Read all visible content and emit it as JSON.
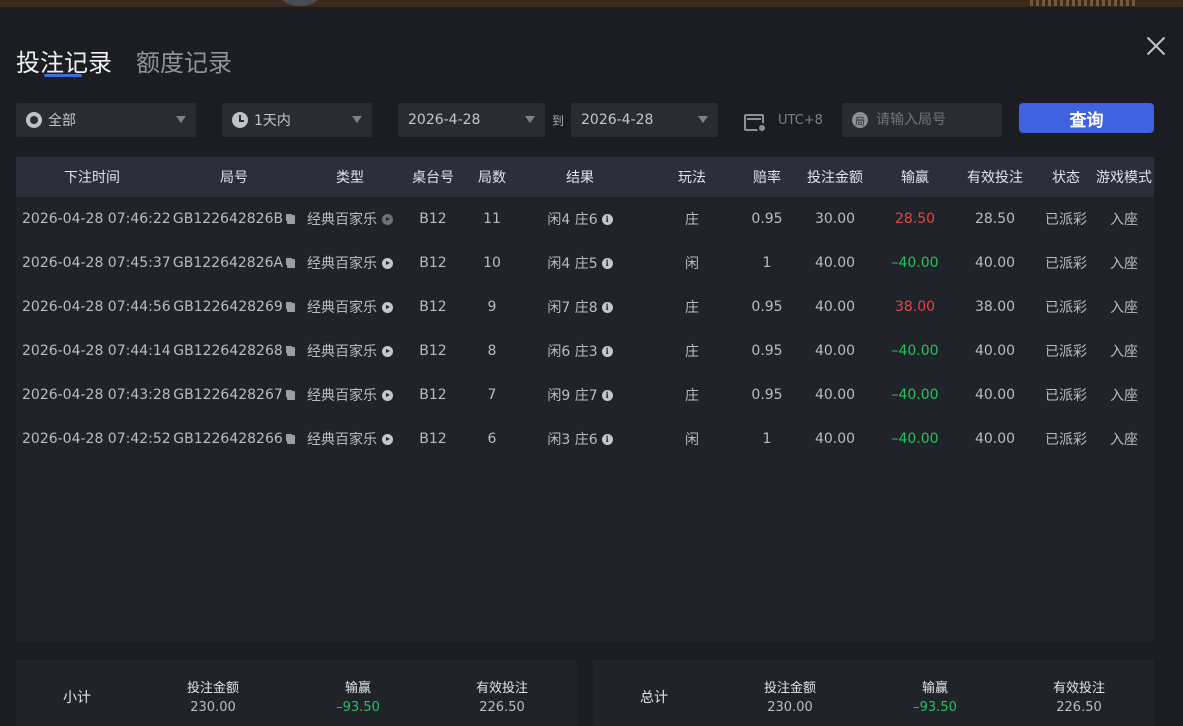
{
  "tabs": [
    {
      "label": "投注记录",
      "active": true
    },
    {
      "label": "额度记录",
      "active": false
    }
  ],
  "filters": {
    "game_type": "全部",
    "time_range": "1天内",
    "date_from": "2026-4-28",
    "to_label": "到",
    "date_to": "2026-4-28",
    "timezone": "UTC+8",
    "round_placeholder": "请输入局号",
    "round_icon_char": "局",
    "query_label": "查询"
  },
  "table": {
    "headers": [
      "下注时间",
      "局号",
      "类型",
      "桌台号",
      "局数",
      "结果",
      "玩法",
      "赔率",
      "投注金额",
      "输赢",
      "有效投注",
      "状态",
      "游戏模式"
    ],
    "rows": [
      {
        "time": "2026-04-28 07:46:22",
        "round": "GB122642826B",
        "type": "经典百家乐",
        "table": "B12",
        "count": "11",
        "result": "闲4 庄6",
        "play": "庄",
        "odds": "0.95",
        "bet": "30.00",
        "winloss": "28.50",
        "effective": "28.50",
        "status": "已派彩",
        "mode": "入座"
      },
      {
        "time": "2026-04-28 07:45:37",
        "round": "GB122642826A",
        "type": "经典百家乐",
        "table": "B12",
        "count": "10",
        "result": "闲4 庄5",
        "play": "闲",
        "odds": "1",
        "bet": "40.00",
        "winloss": "–40.00",
        "effective": "40.00",
        "status": "已派彩",
        "mode": "入座"
      },
      {
        "time": "2026-04-28 07:44:56",
        "round": "GB1226428269",
        "type": "经典百家乐",
        "table": "B12",
        "count": "9",
        "result": "闲7 庄8",
        "play": "庄",
        "odds": "0.95",
        "bet": "40.00",
        "winloss": "38.00",
        "effective": "38.00",
        "status": "已派彩",
        "mode": "入座"
      },
      {
        "time": "2026-04-28 07:44:14",
        "round": "GB1226428268",
        "type": "经典百家乐",
        "table": "B12",
        "count": "8",
        "result": "闲6 庄3",
        "play": "庄",
        "odds": "0.95",
        "bet": "40.00",
        "winloss": "–40.00",
        "effective": "40.00",
        "status": "已派彩",
        "mode": "入座"
      },
      {
        "time": "2026-04-28 07:43:28",
        "round": "GB1226428267",
        "type": "经典百家乐",
        "table": "B12",
        "count": "7",
        "result": "闲9 庄7",
        "play": "庄",
        "odds": "0.95",
        "bet": "40.00",
        "winloss": "–40.00",
        "effective": "40.00",
        "status": "已派彩",
        "mode": "入座"
      },
      {
        "time": "2026-04-28 07:42:52",
        "round": "GB1226428266",
        "type": "经典百家乐",
        "table": "B12",
        "count": "6",
        "result": "闲3 庄6",
        "play": "闲",
        "odds": "1",
        "bet": "40.00",
        "winloss": "–40.00",
        "effective": "40.00",
        "status": "已派彩",
        "mode": "入座"
      }
    ]
  },
  "subtotal": {
    "label": "小计",
    "bet_label": "投注金额",
    "bet": "230.00",
    "winloss_label": "输赢",
    "winloss": "–93.50",
    "effective_label": "有效投注",
    "effective": "226.50"
  },
  "total": {
    "label": "总计",
    "bet_label": "投注金额",
    "bet": "230.00",
    "winloss_label": "输赢",
    "winloss": "–93.50",
    "effective_label": "有效投注",
    "effective": "226.50"
  },
  "colors": {
    "accent": "#3e62e0",
    "win": "#e84242",
    "loss": "#28c25c"
  }
}
